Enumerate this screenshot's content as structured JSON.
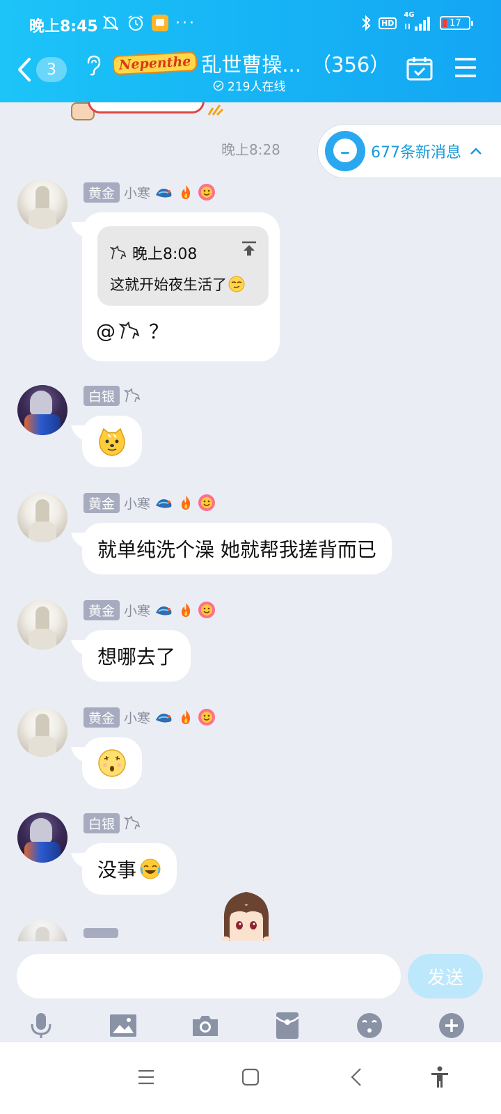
{
  "status_bar": {
    "time": "晚上8:45",
    "dots": "···",
    "hd": "HD",
    "network": "4G",
    "battery": "17"
  },
  "header": {
    "unread_count": "3",
    "group_tag": "Nepenthe",
    "group_name": "乱世曹操...",
    "member_count": "（356）",
    "online_text": "219人在线"
  },
  "chat": {
    "time_label": "晚上8:28",
    "new_messages": "677条新消息",
    "messages": [
      {
        "rank": "黄金",
        "nickname": "小寒",
        "quote": {
          "time": "晚上8:08",
          "text": "这就开始夜生活了"
        },
        "text": "@ ？"
      },
      {
        "rank": "白银",
        "nickname": ""
      },
      {
        "rank": "黄金",
        "nickname": "小寒",
        "text": "就单纯洗个澡 她就帮我搓背而已"
      },
      {
        "rank": "黄金",
        "nickname": "小寒",
        "text": "想哪去了"
      },
      {
        "rank": "黄金",
        "nickname": "小寒"
      },
      {
        "rank": "白银",
        "nickname": "",
        "text": "没事"
      }
    ]
  },
  "input": {
    "placeholder": "",
    "send_label": "发送"
  },
  "toolbar": {
    "icons": [
      "microphone-icon",
      "image-icon",
      "camera-icon",
      "red-packet-icon",
      "emoji-icon",
      "plus-icon"
    ]
  },
  "navbar": {
    "icons": [
      "menu-icon",
      "home-icon",
      "back-icon",
      "accessibility-icon"
    ]
  },
  "colors": {
    "header_blue": "#16b3f5",
    "chat_bg": "#ebedf5",
    "rank_badge": "#a7abbf",
    "accent_text": "#1a9ad9",
    "send_button": "#bde7fb"
  }
}
